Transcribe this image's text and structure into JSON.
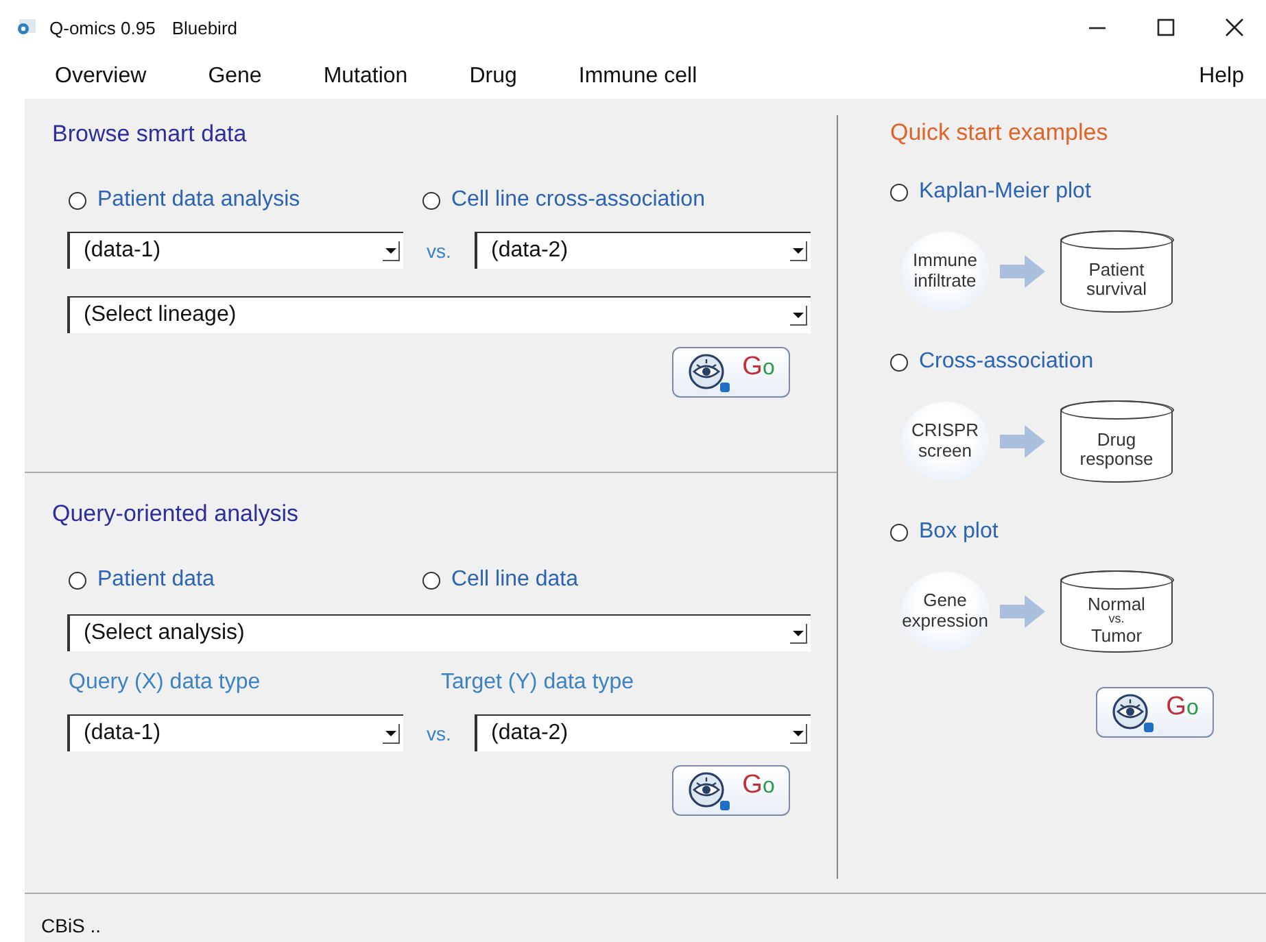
{
  "window": {
    "app": "Q-omics 0.95",
    "subtitle": "Bluebird"
  },
  "menu": {
    "items": [
      "Overview",
      "Gene",
      "Mutation",
      "Drug",
      "Immune cell"
    ],
    "help": "Help"
  },
  "browse": {
    "title": "Browse smart data",
    "radios": [
      {
        "label": "Patient data analysis",
        "selected": false
      },
      {
        "label": "Cell line cross-association",
        "selected": false
      }
    ],
    "pair": {
      "left": "(data-1)",
      "sep": "vs.",
      "right": "(data-2)"
    },
    "lineage": "(Select lineage)",
    "go": "Go"
  },
  "query": {
    "title": "Query-oriented analysis",
    "radios": [
      {
        "label": "Patient data",
        "selected": false
      },
      {
        "label": "Cell line data",
        "selected": false
      }
    ],
    "analysis": "(Select analysis)",
    "labels": [
      "Query (X) data type",
      "Target (Y) data type"
    ],
    "pair": {
      "left": "(data-1)",
      "sep": "vs.",
      "right": "(data-2)"
    },
    "go": "Go"
  },
  "quick": {
    "title": "Quick start examples",
    "examples": [
      {
        "label": "Kaplan-Meier plot",
        "selected": false,
        "source": [
          "Immune",
          "infiltrate"
        ],
        "target": [
          "Patient",
          "survival"
        ]
      },
      {
        "label": "Cross-association",
        "selected": false,
        "source": [
          "CRISPR",
          "screen"
        ],
        "target": [
          "Drug",
          "response"
        ]
      },
      {
        "label": "Box plot",
        "selected": false,
        "source": [
          "Gene",
          "expression"
        ],
        "target": [
          "Normal",
          "vs.",
          "Tumor"
        ]
      }
    ],
    "go": "Go"
  },
  "status": "CBiS .."
}
